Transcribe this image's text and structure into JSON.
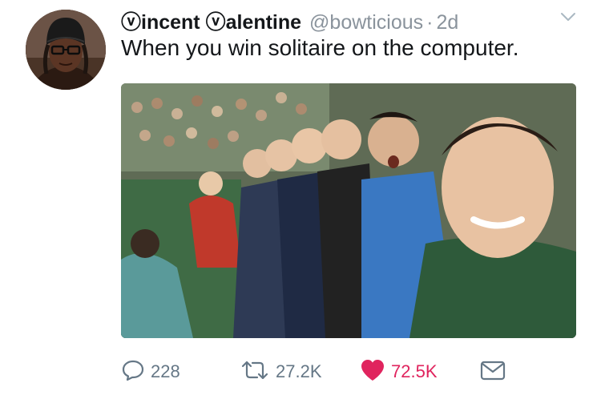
{
  "tweet": {
    "display_name": "ⓥincent ⓥalentine",
    "handle": "@bowticious",
    "separator": "·",
    "time": "2d",
    "text": "When you win solitaire on the computer.",
    "avatar_alt": "profile picture"
  },
  "actions": {
    "reply_count": "228",
    "retweet_count": "27.2K",
    "like_count": "72.5K"
  },
  "icons": {
    "reply": "reply-icon",
    "retweet": "retweet-icon",
    "like": "heart-icon",
    "dm": "envelope-icon",
    "caret": "chevron-down-icon"
  },
  "colors": {
    "like_active": "#e0245e",
    "muted": "#657786",
    "text": "#14171a"
  }
}
